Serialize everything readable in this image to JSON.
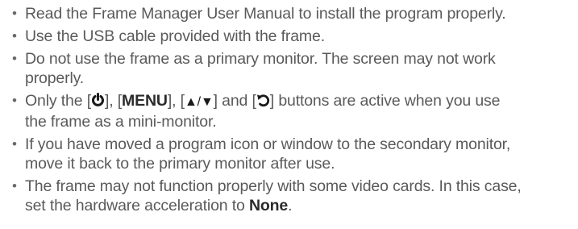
{
  "notes": [
    {
      "text": "Read the Frame Manager User Manual to install the program properly."
    },
    {
      "text": "Use the USB cable provided with the frame."
    },
    {
      "line1": "Do not use the frame as a primary monitor. The screen may not work",
      "line2": "properly."
    },
    {
      "prefix": "Only the [",
      "power_icon": "power-icon",
      "sep1": "], [",
      "menu_key": "MENU",
      "sep2": "], [",
      "up_symbol": "▲",
      "slash": "/",
      "down_symbol": "▼",
      "sep3": "] and [",
      "back_icon": "back-icon",
      "suffix": "] buttons are active when you use",
      "line2": "the frame as a mini-monitor."
    },
    {
      "line1": "If you have moved a program icon or window to the secondary monitor,",
      "line2": "move it back to the primary monitor after use."
    },
    {
      "line1": "The frame may not function properly with some video cards. In this case,",
      "line2_prefix": "set the hardware acceleration to ",
      "line2_value": "None",
      "line2_suffix": "."
    }
  ],
  "colors": {
    "text": "#5a5a5a",
    "emphasis": "#2a2a2a"
  }
}
